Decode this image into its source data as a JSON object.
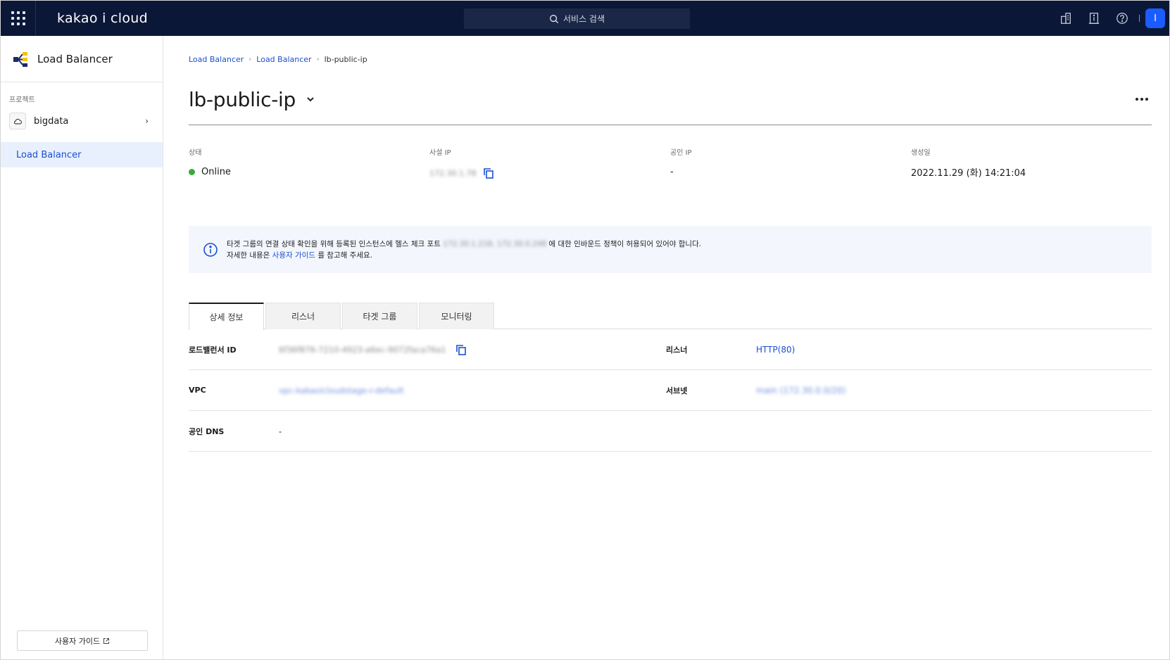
{
  "topbar": {
    "brand": "kakao i cloud",
    "search_placeholder": "서비스 검색",
    "avatar_initial": "I"
  },
  "sidebar": {
    "title": "Load Balancer",
    "section_label": "프로젝트",
    "project_name": "bigdata",
    "nav_item": "Load Balancer",
    "guide_button": "사용자 가이드"
  },
  "main": {
    "breadcrumb": [
      "Load Balancer",
      "Load Balancer",
      "lb-public-ip"
    ],
    "title": "lb-public-ip",
    "summary": {
      "status_label": "상태",
      "status_value": "Online",
      "private_ip_label": "사설 IP",
      "private_ip_value": "172.30.1.78",
      "public_ip_label": "공인 IP",
      "public_ip_value": "-",
      "created_label": "생성일",
      "created_value": "2022.11.29 (화) 14:21:04"
    },
    "notice": {
      "line1_prefix": "타겟 그룹의 연결 상태 확인을 위해 등록된 인스턴스에 헬스 체크 포트",
      "line1_blurred": "172.30.1.218, 172.30.0.248",
      "line1_suffix": "에 대한 인바운드 정책이 허용되어 있어야 합니다.",
      "line2_prefix": "자세한 내용은",
      "line2_link": "사용자 가이드",
      "line2_suffix": "를 참고해 주세요."
    },
    "tabs": [
      "상세 정보",
      "리스너",
      "타겟 그룹",
      "모니터링"
    ],
    "details": {
      "lb_id_label": "로드밸런서 ID",
      "lb_id_value": "6f36f876-7210-4923-a6ec-9072faca76a1",
      "listener_label": "리스너",
      "listener_value": "HTTP(80)",
      "vpc_label": "VPC",
      "vpc_value": "vpc-kakaoicloudstage-r-default",
      "subnet_label": "서브넷",
      "subnet_value": "main (172.30.0.0/20)",
      "dns_label": "공인 DNS",
      "dns_value": "-"
    }
  }
}
